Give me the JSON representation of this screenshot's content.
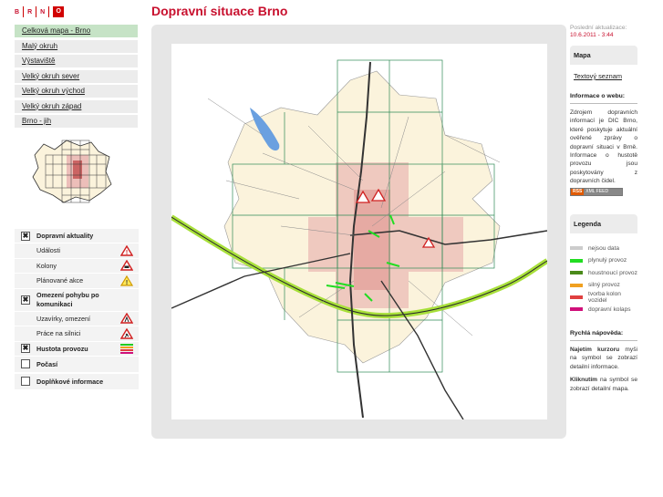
{
  "logo": {
    "letters": [
      "B",
      "R",
      "N",
      "O"
    ]
  },
  "page_title": "Dopravní situace Brno",
  "nav": [
    {
      "label": "Celková mapa - Brno",
      "active": true
    },
    {
      "label": "Malý okruh"
    },
    {
      "label": "Výstaviště"
    },
    {
      "label": "Velký okruh sever"
    },
    {
      "label": "Velký okruh východ"
    },
    {
      "label": "Velký okruh západ"
    },
    {
      "label": "Brno - jih"
    }
  ],
  "layers": {
    "traffic": {
      "label": "Dopravní aktuality",
      "checked": "✖"
    },
    "events": {
      "label": "Události",
      "icon": "warning-red-triangle-icon"
    },
    "queues": {
      "label": "Kolony",
      "icon": "queue-car-triangle-icon"
    },
    "planned": {
      "label": "Plánované akce",
      "icon": "warning-yellow-triangle-icon"
    },
    "restrictions": {
      "label": "Omezení pohybu po komunikaci",
      "checked": "✖"
    },
    "closures": {
      "label": "Uzavírky, omezení",
      "icon": "closure-triangle-icon"
    },
    "roadworks": {
      "label": "Práce na silnici",
      "icon": "roadwork-triangle-icon"
    },
    "density": {
      "label": "Hustota provozu",
      "checked": "✖",
      "icon": "density-stripes-icon"
    },
    "weather": {
      "label": "Počasí",
      "checked": ""
    },
    "extra": {
      "label": "Doplňkové informace",
      "checked": ""
    }
  },
  "update": {
    "label": "Poslední aktualizace:",
    "time": "10.6.2011 - 3:44"
  },
  "tabs": {
    "map": "Mapa",
    "text_list": "Textový seznam"
  },
  "info": {
    "title": "Informace o webu:",
    "text": "Zdrojem dopravních informací je DIC Brno, které poskytuje aktuální ověřené zprávy o dopravní situaci v Brně. Informace o hustotě provozu jsou poskytovány z dopravních čidel.",
    "rss_a": "RSS",
    "rss_b": "XML FEED"
  },
  "legend": {
    "title": "Legenda",
    "items": [
      {
        "label": "nejsou data",
        "color": "#cccccc"
      },
      {
        "label": "plynulý provoz",
        "color": "#22dd22"
      },
      {
        "label": "houstnoucí provoz",
        "color": "#4a8a1a"
      },
      {
        "label": "silný provoz",
        "color": "#f0a020"
      },
      {
        "label": "tvorba kolon vozidel",
        "color": "#e04040"
      },
      {
        "label": "dopravní kolaps",
        "color": "#d0107a"
      }
    ]
  },
  "help": {
    "title": "Rychlá nápověda:",
    "p1_bold": "Najetím kurzoru",
    "p1_rest": " myši na symbol se zobrazí detailní informace.",
    "p2_bold": "Kliknutím",
    "p2_rest": " na symbol se zobrazí detailní mapa."
  },
  "colors": {
    "brand": "#c8102e",
    "active_nav": "#c6e3c6"
  }
}
